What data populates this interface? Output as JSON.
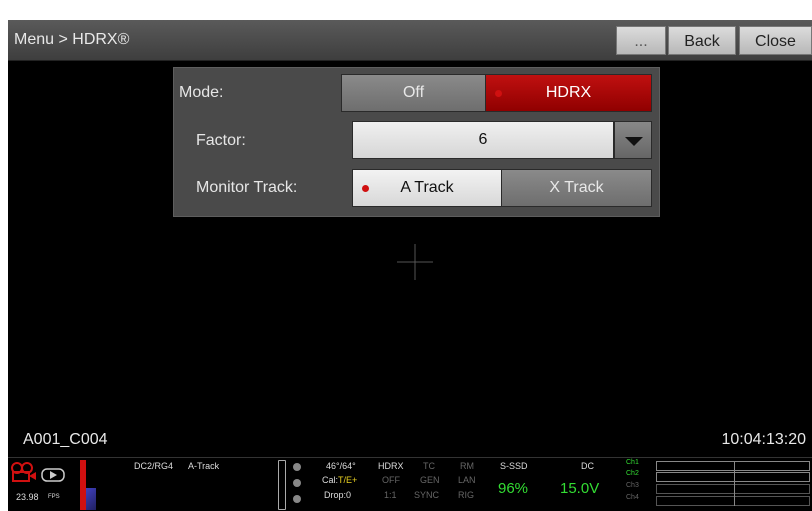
{
  "title_bar": {
    "title": "Menu > HDRX®",
    "more_label": "...",
    "back_label": "Back",
    "close_label": "Close"
  },
  "hdrx_panel": {
    "mode_label": "Mode:",
    "mode_options": [
      "Off",
      "HDRX"
    ],
    "mode_selected": "HDRX",
    "factor_label": "Factor:",
    "factor_value": "6",
    "monitor_track_label": "Monitor Track:",
    "monitor_track_options": [
      "A Track",
      "X Track"
    ],
    "monitor_track_selected": "A Track"
  },
  "viewfinder": {
    "clip_name": "A001_C004",
    "timecode": "10:04:13:20"
  },
  "status_bar": {
    "fps": "23.98",
    "fps_unit": "FPS",
    "look": "DC2/RG4",
    "track": "A-Track",
    "temp": "46°/64°",
    "cal_prefix": "Cal:",
    "cal_value": "T/E+",
    "drop": "Drop:0",
    "hdrx_label": "HDRX",
    "hdrx_value": "OFF",
    "ratio": "1:1",
    "tc_label": "TC",
    "gen_label": "GEN",
    "sync_label": "SYNC",
    "rm_label": "RM",
    "lan_label": "LAN",
    "rig_label": "RIG",
    "media_label": "S-SSD",
    "media_value": "96%",
    "power_label": "DC",
    "power_value": "15.0V",
    "channels": [
      "Ch1",
      "Ch2",
      "Ch3",
      "Ch4"
    ],
    "colors": {
      "accent_red": "#c01010",
      "green": "#33dd33",
      "yellow": "#e8d020"
    }
  }
}
